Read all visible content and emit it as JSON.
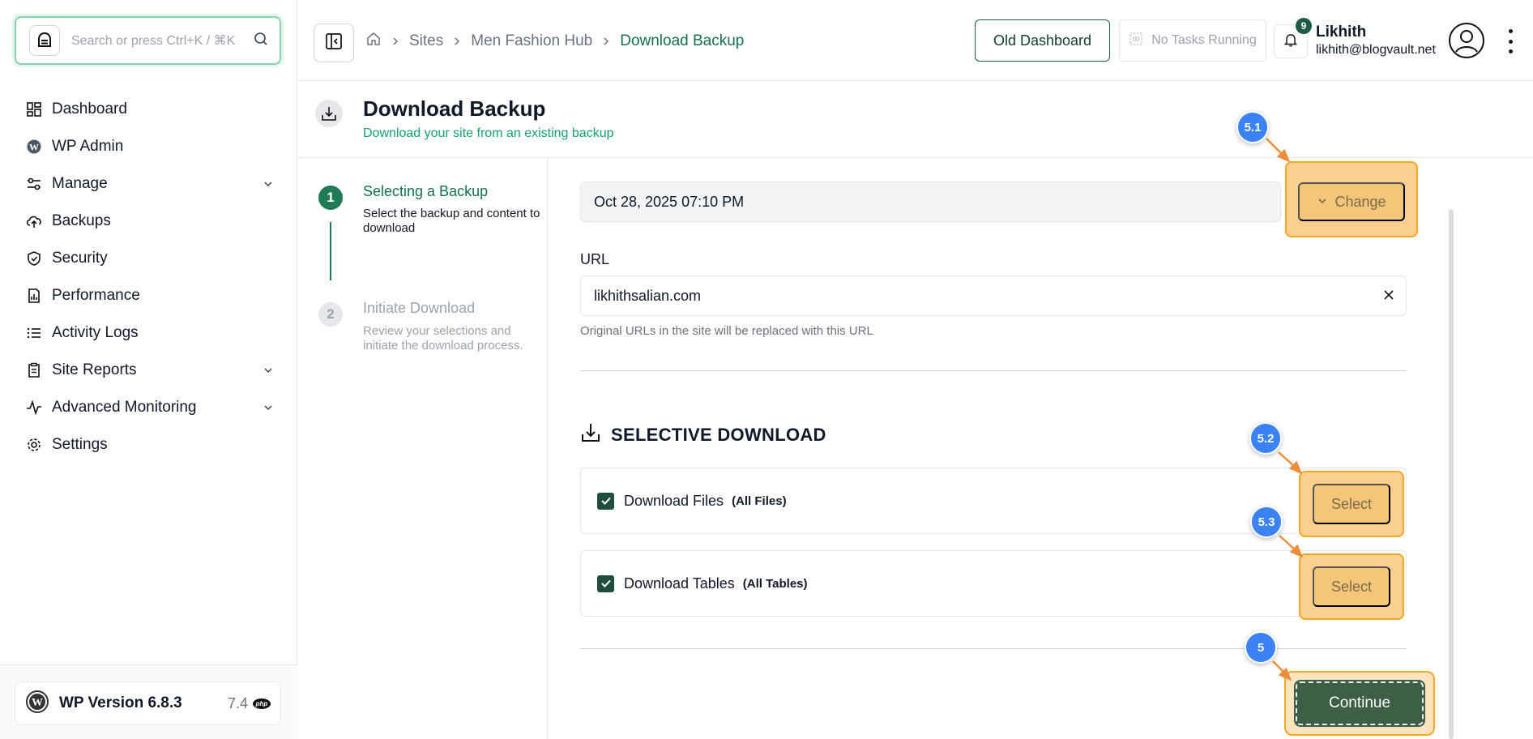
{
  "sidebar": {
    "search_placeholder": "Search or press Ctrl+K / ⌘K",
    "items": [
      {
        "label": "Dashboard",
        "icon": "dashboard-icon",
        "chevron": false
      },
      {
        "label": "WP Admin",
        "icon": "wordpress-icon",
        "chevron": false
      },
      {
        "label": "Manage",
        "icon": "sliders-icon",
        "chevron": true
      },
      {
        "label": "Backups",
        "icon": "cloud-upload-icon",
        "chevron": false
      },
      {
        "label": "Security",
        "icon": "shield-icon",
        "chevron": false
      },
      {
        "label": "Performance",
        "icon": "report-chart-icon",
        "chevron": false
      },
      {
        "label": "Activity Logs",
        "icon": "list-icon",
        "chevron": false
      },
      {
        "label": "Site Reports",
        "icon": "report-icon",
        "chevron": true
      },
      {
        "label": "Advanced Monitoring",
        "icon": "pulse-icon",
        "chevron": true
      },
      {
        "label": "Settings",
        "icon": "gear-icon",
        "chevron": false
      }
    ],
    "footer": {
      "wp_version": "WP Version 6.8.3",
      "php_version": "7.4",
      "php_badge": "php"
    }
  },
  "header": {
    "breadcrumbs": [
      "Sites",
      "Men Fashion Hub",
      "Download Backup"
    ],
    "old_dashboard": "Old Dashboard",
    "tasks": "No Tasks Running",
    "notification_count": "9",
    "user_name": "Likhith",
    "user_email": "likhith@blogvault.net"
  },
  "page": {
    "title": "Download Backup",
    "subtitle": "Download your site from an existing backup"
  },
  "steps": [
    {
      "number": "1",
      "title": "Selecting a Backup",
      "desc": "Select the backup and content to download",
      "active": true
    },
    {
      "number": "2",
      "title": "Initiate Download",
      "desc": "Review your selections and initiate the download process.",
      "active": false
    }
  ],
  "form": {
    "backup_value": "Oct 28, 2025 07:10 PM",
    "change_label": "Change",
    "url_label": "URL",
    "url_value": "likhithsalian.com",
    "url_hint": "Original URLs in the site will be replaced with this URL",
    "selective_title": "SELECTIVE DOWNLOAD",
    "options": [
      {
        "label": "Download Files",
        "sub": "(All Files)",
        "checked": true,
        "button": "Select"
      },
      {
        "label": "Download Tables",
        "sub": "(All Tables)",
        "checked": true,
        "button": "Select"
      }
    ],
    "continue_label": "Continue"
  },
  "annotations": [
    {
      "label": "5.1"
    },
    {
      "label": "5.2"
    },
    {
      "label": "5.3"
    },
    {
      "label": "5"
    }
  ],
  "colors": {
    "brand_green": "#15704d",
    "highlight_orange": "#f5a623",
    "annotation_blue": "#3b82f6",
    "continue_green": "#3d5f46"
  }
}
